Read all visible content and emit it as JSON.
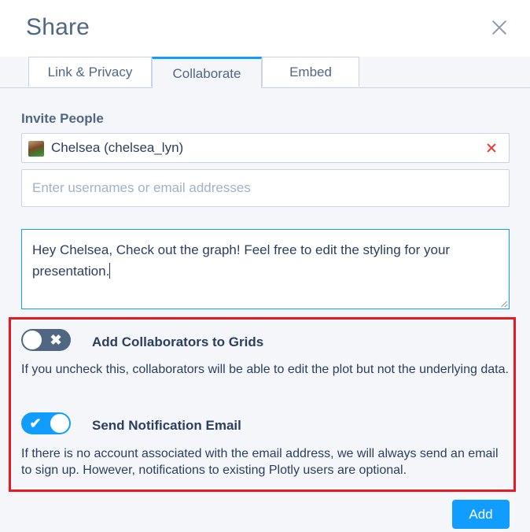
{
  "dialog": {
    "title": "Share"
  },
  "tabs": [
    {
      "label": "Link & Privacy",
      "active": false
    },
    {
      "label": "Collaborate",
      "active": true
    },
    {
      "label": "Embed",
      "active": false
    }
  ],
  "invite": {
    "label": "Invite People",
    "chip": {
      "text": "Chelsea (chelsea_lyn)",
      "icon": "user-avatar"
    },
    "input": {
      "value": "",
      "placeholder": "Enter usernames or email addresses"
    },
    "message": "Hey Chelsea, Check out the graph! Feel free to edit the styling for your presentation."
  },
  "options": [
    {
      "title": "Add Collaborators to Grids",
      "enabled": false,
      "description": "If you uncheck this, collaborators will be able to edit the plot but not the underlying data."
    },
    {
      "title": "Send Notification Email",
      "enabled": true,
      "description": "If there is no account associated with the email address, we will always send an email to sign up. However, notifications to existing Plotly users are optional."
    }
  ],
  "actions": {
    "add_label": "Add"
  },
  "colors": {
    "accent": "#119dff",
    "highlight": "#e51b24",
    "remove": "#ef3a35",
    "toggle_off": "#506784"
  }
}
